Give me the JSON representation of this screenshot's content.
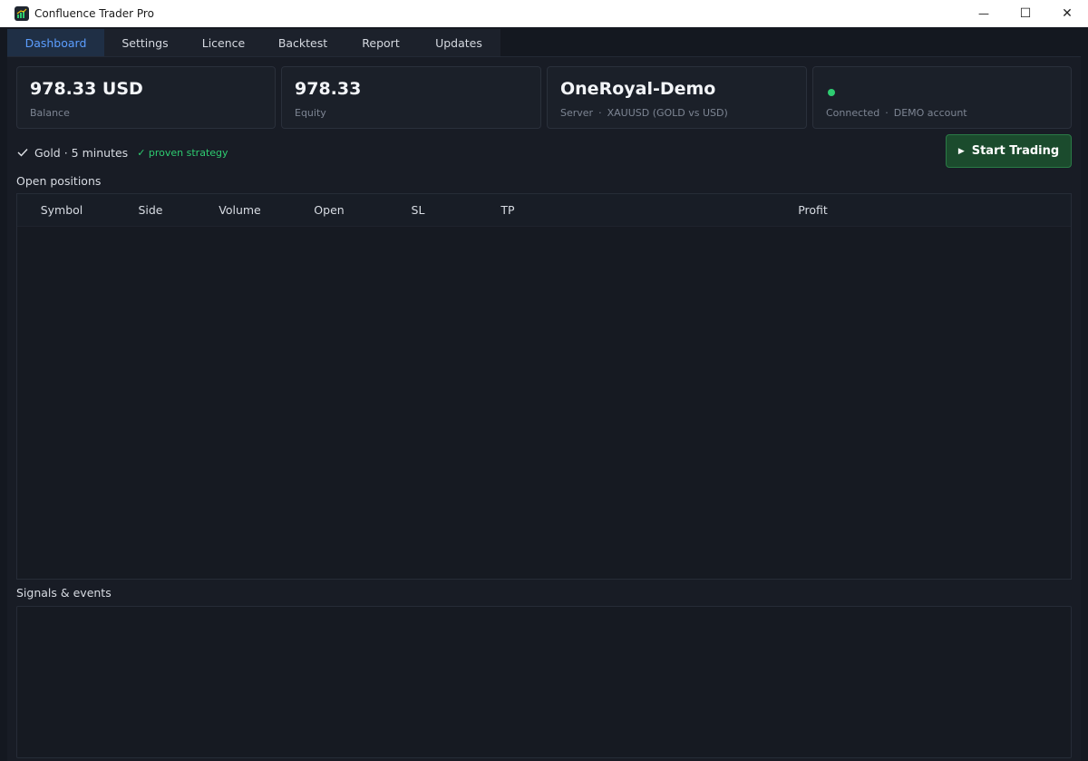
{
  "window": {
    "title": "Confluence Trader Pro",
    "controls": {
      "minimize": "—",
      "maximize": "☐",
      "close": "✕"
    }
  },
  "tabs": [
    {
      "label": "Dashboard",
      "active": true
    },
    {
      "label": "Settings",
      "active": false
    },
    {
      "label": "Licence",
      "active": false
    },
    {
      "label": "Backtest",
      "active": false
    },
    {
      "label": "Report",
      "active": false
    },
    {
      "label": "Updates",
      "active": false
    }
  ],
  "cards": {
    "balance": {
      "value": "978.33 USD",
      "label": "Balance"
    },
    "equity": {
      "value": "978.33",
      "label": "Equity"
    },
    "server": {
      "value": "OneRoyal-Demo",
      "label": "Server",
      "detail": "XAUUSD (GOLD vs USD)"
    },
    "connection": {
      "status": "Connected",
      "detail": "DEMO account",
      "dot_color": "#2ecc71"
    }
  },
  "strategy": {
    "text": "Gold · 5 minutes",
    "badge": "✓ proven strategy"
  },
  "start_button": {
    "label": "Start Trading",
    "icon": "play-icon"
  },
  "positions": {
    "title": "Open positions",
    "columns": [
      "Symbol",
      "Side",
      "Volume",
      "Open",
      "SL",
      "TP",
      "Profit"
    ],
    "rows": []
  },
  "events": {
    "title": "Signals & events"
  },
  "colors": {
    "accent": "#5c9eff",
    "success": "#2ecc71",
    "start_button_bg": "#1b4b2d"
  }
}
